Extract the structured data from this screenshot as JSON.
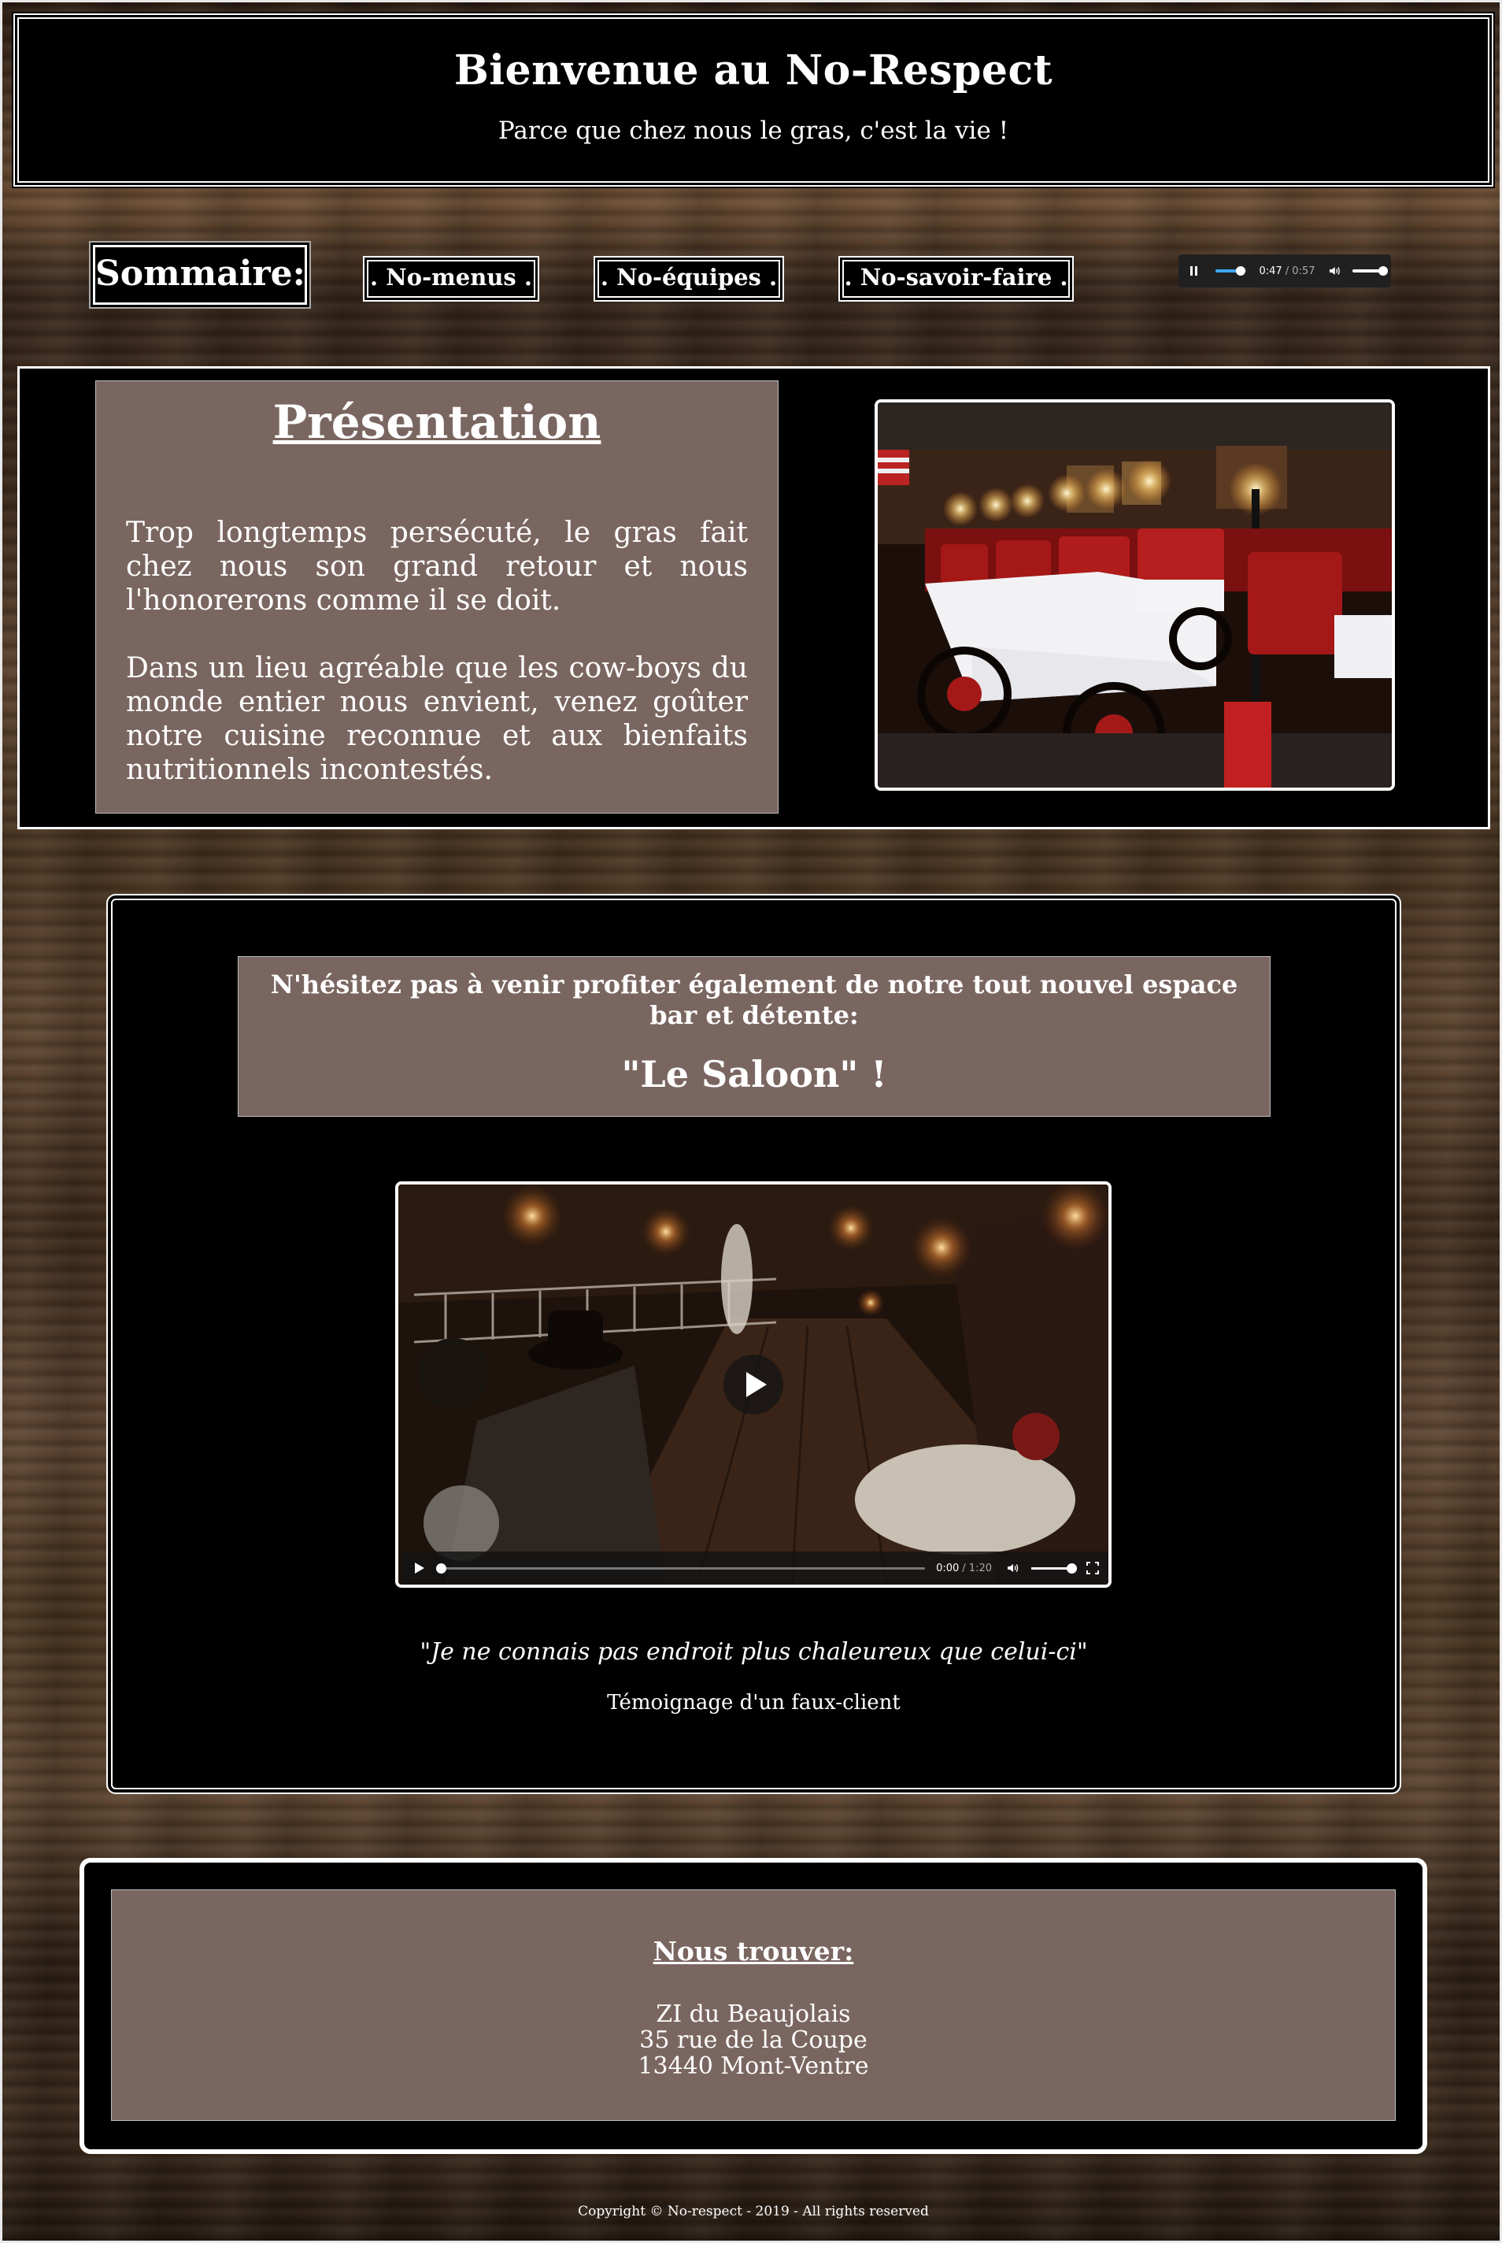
{
  "header": {
    "title": "Bienvenue au No-Respect",
    "subtitle": "Parce que chez nous le gras, c'est la vie !"
  },
  "nav": {
    "sommaire": "Sommaire:",
    "items": [
      {
        "label": ". No-menus ."
      },
      {
        "label": ". No-équipes ."
      },
      {
        "label": ". No-savoir-faire ."
      }
    ]
  },
  "audio_player": {
    "current_time": "0:47",
    "duration": "/ 0:57",
    "progress": 0.82,
    "volume": 1.0,
    "state": "playing"
  },
  "presentation": {
    "title": "Présentation",
    "paragraph1": "Trop longtemps persécuté, le gras fait chez nous son grand retour et nous l'honorerons comme il se doit.",
    "paragraph2": "Dans un lieu agréable que les cow-boys du monde entier nous envient, venez goûter notre cuisine reconnue et aux bienfaits nutritionnels incontestés."
  },
  "saloon": {
    "intro": "N'hésitez pas à venir profiter également de notre tout nouvel espace bar et détente:",
    "name": "\"Le Saloon\" !",
    "video": {
      "current_time": "0:00",
      "duration": "/ 1:20",
      "progress": 0.0,
      "volume": 1.0
    },
    "quote": "\"Je ne connais pas endroit plus chaleureux que celui-ci\"",
    "quote_author": "Témoignage d'un faux-client"
  },
  "findus": {
    "title": "Nous trouver:",
    "address": [
      "ZI du Beaujolais",
      "35 rue de la Coupe",
      "13440 Mont-Ventre"
    ]
  },
  "footer": {
    "copyright": "Copyright © No-respect - 2019 - All rights reserved"
  },
  "colors": {
    "panel": "#000000",
    "card": "#7a6660",
    "text": "#ffffff",
    "accent": "#3ea6ff"
  }
}
